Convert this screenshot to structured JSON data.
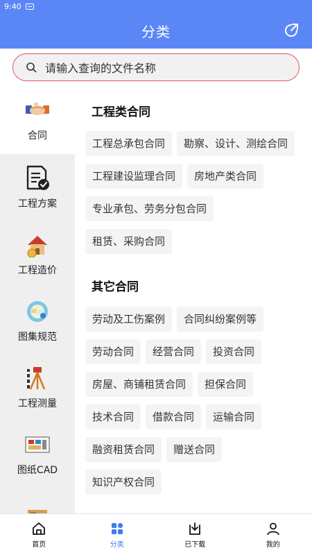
{
  "status_bar": {
    "time": "9:40"
  },
  "header": {
    "title": "分类"
  },
  "search": {
    "placeholder": "请输入查询的文件名称"
  },
  "sidebar": {
    "items": [
      {
        "label": "合同"
      },
      {
        "label": "工程方案"
      },
      {
        "label": "工程造价"
      },
      {
        "label": "图集规范"
      },
      {
        "label": "工程测量"
      },
      {
        "label": "图纸CAD"
      }
    ]
  },
  "sections": [
    {
      "title": "工程类合同",
      "tags": [
        "工程总承包合同",
        "勘察、设计、测绘合同",
        "工程建设监理合同",
        "房地产类合同",
        "专业承包、劳务分包合同",
        "租赁、采购合同"
      ]
    },
    {
      "title": "其它合同",
      "tags": [
        "劳动及工伤案例",
        "合同纠纷案例等",
        "劳动合同",
        "经营合同",
        "投资合同",
        "房屋、商铺租赁合同",
        "担保合同",
        "技术合同",
        "借款合同",
        "运输合同",
        "融资租赁合同",
        "赠送合同",
        "知识产权合同"
      ]
    }
  ],
  "tabbar": {
    "items": [
      {
        "label": "首页"
      },
      {
        "label": "分类"
      },
      {
        "label": "已下载"
      },
      {
        "label": "我的"
      }
    ]
  },
  "colors": {
    "primary": "#5b87f6",
    "active_tab": "#3d7cf5",
    "search_border": "#e8505b"
  }
}
